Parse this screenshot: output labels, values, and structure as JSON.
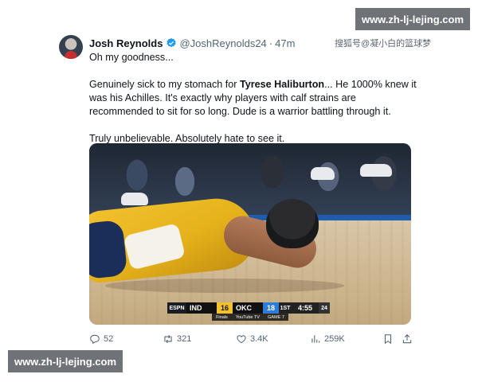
{
  "tweet": {
    "author_name": "Josh Reynolds",
    "handle": "@JoshReynolds24",
    "separator": "·",
    "time": "47m",
    "line1": "Oh my goodness...",
    "p2_pre": "Genuinely sick to my stomach for ",
    "p2_bold": "Tyrese Haliburton",
    "p2_post": "... He 1000% knew it was his Achilles. It's exactly why players with calf strains are recommended to sit for so long. Dude is a warrior battling through it.",
    "p3": "Truly unbelievable. Absolutely hate to see it."
  },
  "scorebug": {
    "network": "ESPN",
    "team1": "IND",
    "score1": "16",
    "team2": "OKC",
    "score2": "18",
    "quarter": "1ST",
    "clock": "4:55",
    "shot_clock": "24",
    "sub_left": "Finals",
    "sub_mid": "YouTube TV",
    "sub_right": "GAME 7"
  },
  "actions": {
    "replies": "52",
    "retweets": "321",
    "likes": "3.4K",
    "views": "259K"
  },
  "watermarks": {
    "top": "www.zh-lj-lejing.com",
    "bottom": "www.zh-lj-lejing.com",
    "cn": "搜狐号@凝小白的篮球梦"
  },
  "colors": {
    "accent_blue": "#1d9bf0",
    "text_primary": "#0f1419",
    "text_secondary": "#536471",
    "ind_yellow": "#f2c12e",
    "okc_blue": "#2f7cd6"
  },
  "icons": [
    "verified-badge-icon",
    "reply-icon",
    "retweet-icon",
    "like-icon",
    "views-icon",
    "bookmark-icon",
    "share-icon"
  ]
}
